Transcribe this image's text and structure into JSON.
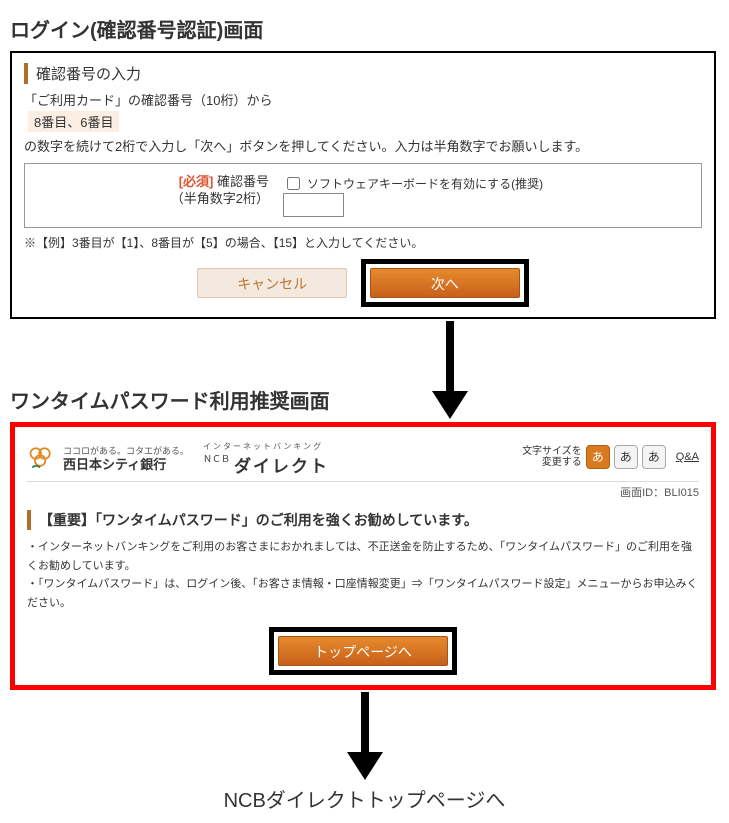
{
  "section1": {
    "title": "ログイン(確認番号認証)画面",
    "heading": "確認番号の入力",
    "line1": "「ご利用カード」の確認番号（10桁）から",
    "digits": "8番目、6番目",
    "line2": "の数字を続けて2桁で入力し「次へ」ボタンを押してください。入力は半角数字でお願いします。",
    "required": "[必須]",
    "field_label": "確認番号",
    "field_hint": "（半角数字2桁）",
    "checkbox_label": "ソフトウェアキーボードを有効にする(推奨)",
    "example": "※【例】3番目が【1】、8番目が【5】の場合、【15】と入力してください。",
    "cancel": "キャンセル",
    "next": "次へ"
  },
  "section2": {
    "title": "ワンタイムパスワード利用推奨画面",
    "tag1": "ココロがある。コタエがある。",
    "bank": "西日本シティ銀行",
    "tag2": "インターネットバンキング",
    "direct_small": "ＮＣＢ",
    "direct": "ダイレクト",
    "font_label": "文字サイズを\n変更する",
    "font_s": "あ",
    "font_m": "あ",
    "font_l": "あ",
    "qa": "Q&A",
    "screen_id": "画面ID：BLI015",
    "heading": "【重要】「ワンタイムパスワード」のご利用を強くお勧めしています。",
    "bullet1": "インターネットバンキングをご利用のお客さまにおかれましては、不正送金を防止するため、「ワンタイムパスワード」のご利用を強くお勧めしています。",
    "bullet2": "「ワンタイムパスワード」は、ログイン後、「お客さま情報・口座情報変更」⇒「ワンタイムパスワード設定」メニューからお申込みください。",
    "topbtn": "トップページへ"
  },
  "final": "NCBダイレクトトップページへ"
}
